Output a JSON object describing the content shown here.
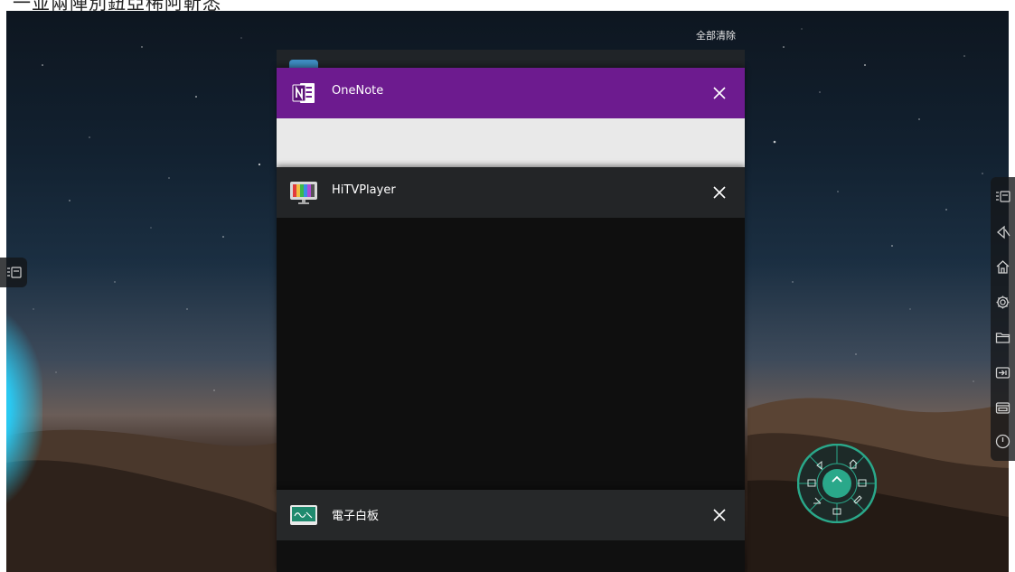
{
  "header": {
    "caption": "一並兩陣別鈕亞稀阿靳悉"
  },
  "recents": {
    "clear_all_label": "全部清除",
    "cards": [
      {
        "title": "OneNote",
        "icon": "onenote-icon",
        "header_color": "#6d1b8f"
      },
      {
        "title": "HiTVPlayer",
        "icon": "tv-player-icon",
        "header_color": "#232527"
      },
      {
        "title": "電子白板",
        "icon": "whiteboard-icon",
        "header_color": "#262829"
      }
    ]
  },
  "side_dock_right": {
    "icons": [
      "recent-apps-icon",
      "back-icon",
      "home-icon",
      "settings-icon",
      "folder-icon",
      "input-source-icon",
      "screen-icon",
      "power-icon"
    ]
  },
  "side_dock_left": {
    "icons": [
      "recent-apps-icon"
    ]
  },
  "float_menu": {
    "icons": [
      "back-icon",
      "home-icon",
      "recent-apps-icon",
      "sidebar-icon",
      "pen-icon",
      "eraser-icon",
      "chevron-up-icon"
    ],
    "accent": "#2aa88a"
  },
  "colors": {
    "onenote_purple": "#6d1b8f",
    "dock_bg": "#141618",
    "accent_teal": "#2aa88a"
  }
}
